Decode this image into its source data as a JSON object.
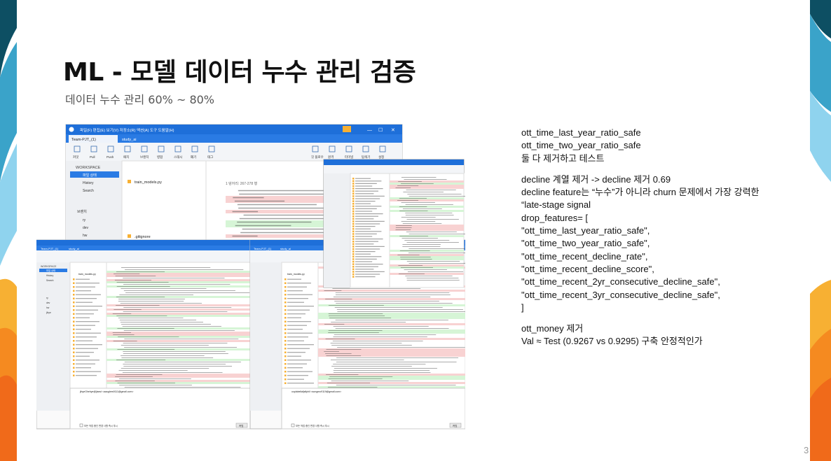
{
  "slide": {
    "title": "ML - 모델 데이터 누수 관리 검증",
    "subtitle": "데이터 누수 관리 60% ~ 80%",
    "page_number": "3"
  },
  "notes": {
    "block1": [
      "ott_time_last_year_ratio_safe",
      "ott_time_two_year_ratio_safe",
      "둘 다 제거하고 테스트"
    ],
    "block2": [
      "decline 계열 제거 -> decline 제거        0.69",
      "decline feature는 “누수”가 아니라 churn 문제에서 가장 강력한",
      "“late-stage signal",
      "drop_features= [",
      "\"ott_time_last_year_ratio_safe\",",
      "\"ott_time_two_year_ratio_safe\",",
      "\"ott_time_recent_decline_rate\",",
      "\"ott_time_recent_decline_score\",",
      "\"ott_time_recent_2yr_consecutive_decline_safe\",",
      "\"ott_time_recent_3yr_consecutive_decline_safe\",",
      "]"
    ],
    "block3": [
      "ott_money 제거",
      "Val ≈ Test (0.9267 vs 0.9295) 구축 안정적인가"
    ]
  },
  "screenshot": {
    "main_window": {
      "menu": "파일(F)  편집(E)  보기(V)  저장소(R)  액션(A)  도구  도움말(H)",
      "tab_active": "Team-PJT_(1)",
      "tab_other": "study_ai",
      "toolbar": [
        "커밋",
        "Pull",
        "Push",
        "패치",
        "브랜치",
        "병합",
        "스태시",
        "폐기",
        "태그",
        "깃 플로우",
        "원격",
        "터미널",
        "탐색기",
        "설정"
      ],
      "workspace": "WORKSPACE",
      "sidebar_items": [
        "파일 상태",
        "History",
        "Search"
      ],
      "branch_header": "브랜치",
      "branches": [
        "ry",
        "dev",
        "hw"
      ],
      "file_name": "train_models.py",
      "file_name_2": ".gitignore",
      "hunk": "1 덩어리: 267-278 행"
    },
    "bottom_left": {
      "title": "Team-PJT_(1)",
      "tab": "study_ai",
      "file": "train_models.py",
      "sidebar": [
        "WORKSPACE",
        "파일 상태",
        "History",
        "Search"
      ],
      "branches": [
        "ry",
        "dev",
        "hw",
        "jihye"
      ],
      "author": "jihyeGhehye@jiseut <aaughes9111@gmail.com>",
      "checkbox": "모든 작업 중인 변경 사항 즉시 푸시",
      "commit_button": "커밋"
    },
    "bottom_right": {
      "title": "Team-PJT_(1)",
      "tab": "study_ai",
      "file": "train_models.py",
      "author": "ooplabellafjsfiphil <songmo9119@gmail.com>",
      "checkbox": "모든 작업 중인 변경 사항 즉시 푸시",
      "commit_button": "커밋"
    }
  },
  "colors": {
    "accent_blue": "#1e6fd9",
    "diff_removed": "#f8d2d2",
    "diff_added": "#d6f5d6",
    "deco_dark": "#0d4f63",
    "deco_teal": "#3aa3c9",
    "deco_orange": "#f06a1a",
    "deco_yellow": "#f7b033"
  }
}
